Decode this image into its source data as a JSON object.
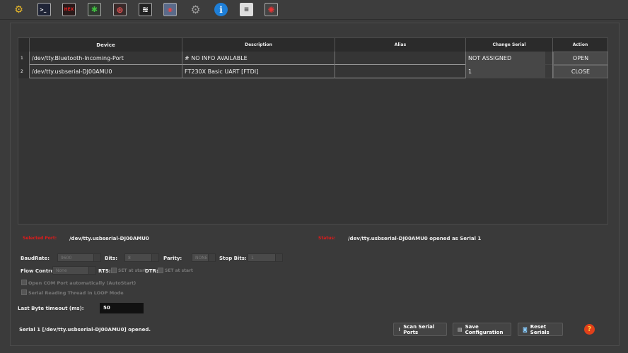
{
  "toolbar": {
    "icons": [
      "settings-icon",
      "terminal-icon",
      "hex-icon",
      "bug-icon",
      "target-icon",
      "layers-icon",
      "chat-icon",
      "disabled-gear-icon",
      "info-icon",
      "config-doc-icon",
      "robot-icon"
    ],
    "hex_label": "HEX",
    "info_label": "i"
  },
  "table": {
    "headers": [
      "Device",
      "Description",
      "Alias",
      "Change Serial",
      "Action"
    ],
    "rows": [
      {
        "index": "1",
        "device": "/dev/tty.Bluetooth-Incoming-Port",
        "description": "# NO INFO AVAILABLE",
        "alias": "",
        "serial": "NOT ASSIGNED",
        "action": "OPEN"
      },
      {
        "index": "2",
        "device": "/dev/tty.usbserial-DJ00AMU0",
        "description": "FT230X Basic UART [FTDI]",
        "alias": "",
        "serial": "1",
        "action": "CLOSE"
      }
    ]
  },
  "selected_port": {
    "label": "Selected Port:",
    "value": "/dev/tty.usbserial-DJ00AMU0"
  },
  "status": {
    "label": "Status:",
    "value": "/dev/tty.usbserial-DJ00AMU0 opened as Serial 1"
  },
  "settings": {
    "baud_label": "BaudRate:",
    "baud": "9600",
    "bits_label": "Bits:",
    "bits": "8",
    "parity_label": "Parity:",
    "parity": "NONE",
    "stop_label": "Stop Bits:",
    "stop": "1",
    "flow_label": "Flow Control:",
    "flow": "None",
    "rts_label": "RTS:",
    "rts_text": "SET at start",
    "dtr_label": "DTR:",
    "dtr_text": "SET at start",
    "autostart": "Open COM Port automatically (AutoStart)",
    "loop": "Serial Reading Thread in LOOP Mode",
    "timeout_label": "Last Byte timeout (ms):",
    "timeout": "50"
  },
  "footer": {
    "message": "Serial 1 [/dev/tty.usbserial-DJ00AMU0] opened.",
    "scan": "Scan Serial Ports",
    "save": "Save Configuration",
    "reset": "Reset Serials",
    "help": "?"
  },
  "colors": {
    "red_label": "#e01b1b",
    "accent_blue": "#1e7fd8"
  }
}
